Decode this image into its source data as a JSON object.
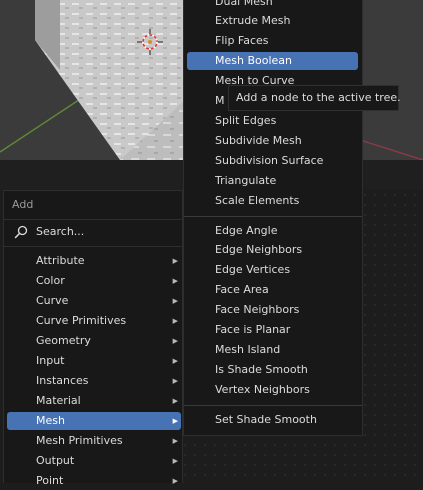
{
  "add_menu": {
    "title": "Add",
    "search_label": "Search...",
    "search_icon": "search-icon",
    "categories": [
      {
        "label": "Attribute",
        "active": false
      },
      {
        "label": "Color",
        "active": false
      },
      {
        "label": "Curve",
        "active": false
      },
      {
        "label": "Curve Primitives",
        "active": false
      },
      {
        "label": "Geometry",
        "active": false
      },
      {
        "label": "Input",
        "active": false
      },
      {
        "label": "Instances",
        "active": false
      },
      {
        "label": "Material",
        "active": false
      },
      {
        "label": "Mesh",
        "active": true
      },
      {
        "label": "Mesh Primitives",
        "active": false
      },
      {
        "label": "Output",
        "active": false
      },
      {
        "label": "Point",
        "active": false
      }
    ]
  },
  "mesh_submenu": {
    "operations": [
      {
        "label": "Dual Mesh",
        "active": false
      },
      {
        "label": "Extrude Mesh",
        "active": false
      },
      {
        "label": "Flip Faces",
        "active": false
      },
      {
        "label": "Mesh Boolean",
        "active": true
      },
      {
        "label": "Mesh to Curve",
        "active": false
      },
      {
        "label": "M",
        "active": false
      },
      {
        "label": "Split Edges",
        "active": false
      },
      {
        "label": "Subdivide Mesh",
        "active": false
      },
      {
        "label": "Subdivision Surface",
        "active": false
      },
      {
        "label": "Triangulate",
        "active": false
      },
      {
        "label": "Scale Elements",
        "active": false
      }
    ],
    "read": [
      {
        "label": "Edge Angle"
      },
      {
        "label": "Edge Neighbors"
      },
      {
        "label": "Edge Vertices"
      },
      {
        "label": "Face Area"
      },
      {
        "label": "Face Neighbors"
      },
      {
        "label": "Face is Planar"
      },
      {
        "label": "Mesh Island"
      },
      {
        "label": "Is Shade Smooth"
      },
      {
        "label": "Vertex Neighbors"
      }
    ],
    "write": [
      {
        "label": "Set Shade Smooth"
      }
    ]
  },
  "tooltip": {
    "text": "Add a node to the active tree."
  },
  "colors": {
    "accent": "#4772b3",
    "menu_bg": "#181818",
    "editor_bg": "#1d1d1d"
  }
}
